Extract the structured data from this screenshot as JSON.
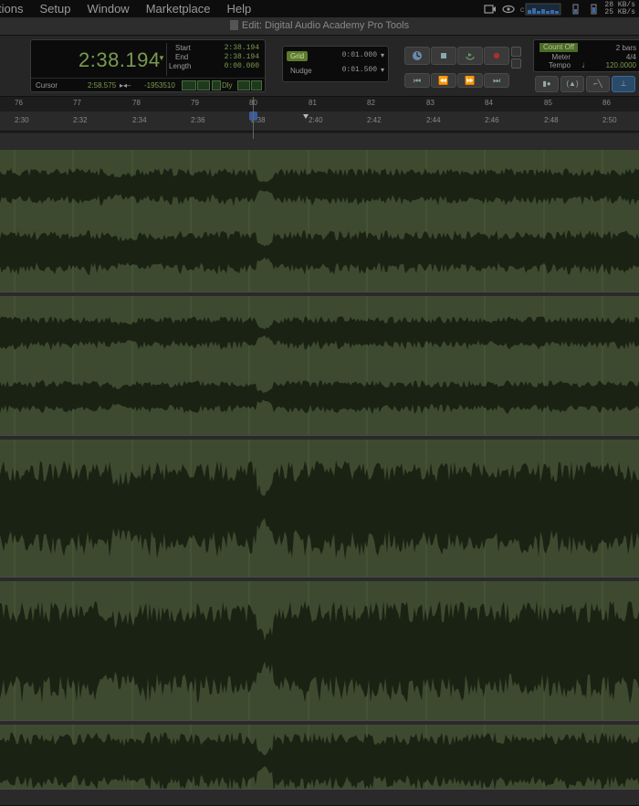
{
  "menubar": {
    "items": [
      "tions",
      "Setup",
      "Window",
      "Marketplace",
      "Help"
    ],
    "net_up": "28 KB/s",
    "net_down": "25 KB/s"
  },
  "window": {
    "title": "Edit: Digital Audio Academy Pro Tools"
  },
  "counter": {
    "main_time": "2:38.194",
    "start_label": "Start",
    "start": "2:38.194",
    "end_label": "End",
    "end": "2:38.194",
    "length_label": "Length",
    "length": "0:00.000",
    "cursor_label": "Cursor",
    "cursor": "2:58.575",
    "sample_value": "-1953510",
    "dly_label": "Dly"
  },
  "grid_nudge": {
    "grid_label": "Grid",
    "grid_value": "0:01.000",
    "nudge_label": "Nudge",
    "nudge_value": "0:01.500"
  },
  "meter_box": {
    "count_off_label": "Count Off",
    "count_off_value": "2 bars",
    "meter_label": "Meter",
    "meter_value": "4/4",
    "tempo_label": "Tempo",
    "tempo_value": "120.0000"
  },
  "timeline": {
    "bars": [
      "76",
      "77",
      "78",
      "79",
      "80",
      "81",
      "82",
      "83",
      "84",
      "85",
      "86"
    ],
    "minsecs": [
      "2:30",
      "2:32",
      "2:34",
      "2:36",
      "2:38",
      "2:40",
      "2:42",
      "2:44",
      "2:46",
      "2:48",
      "2:50"
    ]
  },
  "colors": {
    "track_bg": "#3d4a2f",
    "waveform": "#1a2214",
    "lcd_text": "#7a9a4e"
  }
}
